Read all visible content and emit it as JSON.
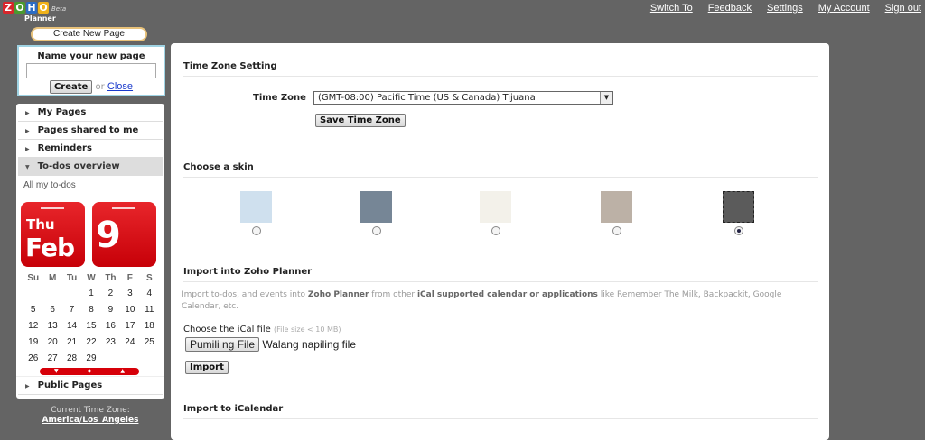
{
  "logo": {
    "letters": [
      "Z",
      "O",
      "H",
      "O"
    ],
    "beta": "Beta",
    "product": "Planner"
  },
  "toplinks": [
    "Switch To",
    "Feedback",
    "Settings",
    "My Account",
    "Sign out"
  ],
  "sidebar": {
    "create_new_page": "Create New  Page",
    "name_title": "Name your new page",
    "name_value": "",
    "create": "Create",
    "or": "or",
    "close": "Close",
    "nav": [
      "My Pages",
      "Pages shared to me",
      "Reminders",
      "To-dos overview"
    ],
    "all_todos": "All my to-dos",
    "calendar": {
      "weekday": "Thu",
      "month": "Feb",
      "day": "9",
      "headers": [
        "Su",
        "M",
        "Tu",
        "W",
        "Th",
        "F",
        "S"
      ],
      "weeks": [
        [
          "",
          "",
          "",
          "1",
          "2",
          "3",
          "4"
        ],
        [
          "5",
          "6",
          "7",
          "8",
          "9",
          "10",
          "11"
        ],
        [
          "12",
          "13",
          "14",
          "15",
          "16",
          "17",
          "18"
        ],
        [
          "19",
          "20",
          "21",
          "22",
          "23",
          "24",
          "25"
        ],
        [
          "26",
          "27",
          "28",
          "29",
          "",
          "",
          ""
        ]
      ]
    },
    "public_pages": "Public Pages",
    "tz_label": "Current Time Zone:",
    "tz_value": "America/Los_Angeles"
  },
  "main": {
    "tz_section": "Time Zone Setting",
    "tz_label": "Time Zone",
    "tz_selected": "(GMT-08:00) Pacific Time (US & Canada) Tijuana",
    "save_tz": "Save Time Zone",
    "skin_section": "Choose a skin",
    "skins": [
      {
        "color": "#cfe0ee",
        "selected": false
      },
      {
        "color": "#768696",
        "selected": false
      },
      {
        "color": "#f3f1ea",
        "selected": false
      },
      {
        "color": "#bcb1a6",
        "selected": false
      },
      {
        "color": "#5b5b5b",
        "selected": true
      }
    ],
    "import_section": "Import into Zoho Planner",
    "import_desc": {
      "p1": "Import to-dos, and events into ",
      "b1": "Zoho Planner",
      "p2": " from other ",
      "b2": "iCal supported calendar or applications",
      "p3": " like Remember The Milk, Backpackit, Google Calendar, etc."
    },
    "choose_label": "Choose the iCal file",
    "file_size": "(File size < 10 MB)",
    "file_button": "Pumili ng File",
    "file_status": "Walang napiling file",
    "import_button": "Import",
    "export_section": "Import to iCalendar"
  }
}
